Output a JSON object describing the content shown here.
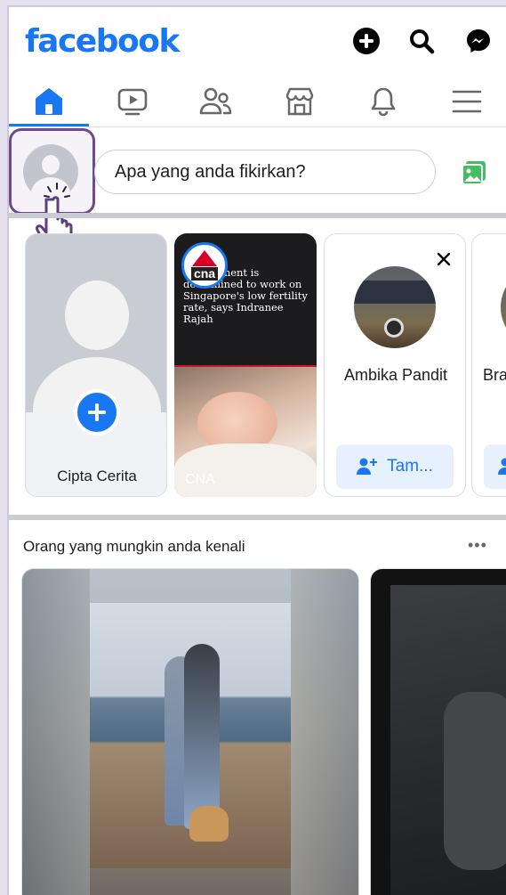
{
  "app": {
    "logo": "facebook",
    "brand_color": "#1877f2"
  },
  "header": {
    "icons": [
      "add-icon",
      "search-icon",
      "messenger-icon"
    ]
  },
  "nav": {
    "active": "home",
    "tabs": [
      "home",
      "video",
      "friends",
      "marketplace",
      "notifications",
      "menu"
    ]
  },
  "composer": {
    "placeholder": "Apa yang anda fikirkan?"
  },
  "stories": {
    "create_label": "Cipta Cerita",
    "cna": {
      "source": "CNA",
      "logo_text": "cna",
      "headline": "Government is determined to work on Singapore's low fertility rate, says Indranee Rajah"
    },
    "suggestion": {
      "name": "Ambika Pandit",
      "add_label": "Tam..."
    },
    "partial_name": "Bra"
  },
  "pymk": {
    "title": "Orang yang mungkin anda kenali",
    "more": "•••"
  }
}
